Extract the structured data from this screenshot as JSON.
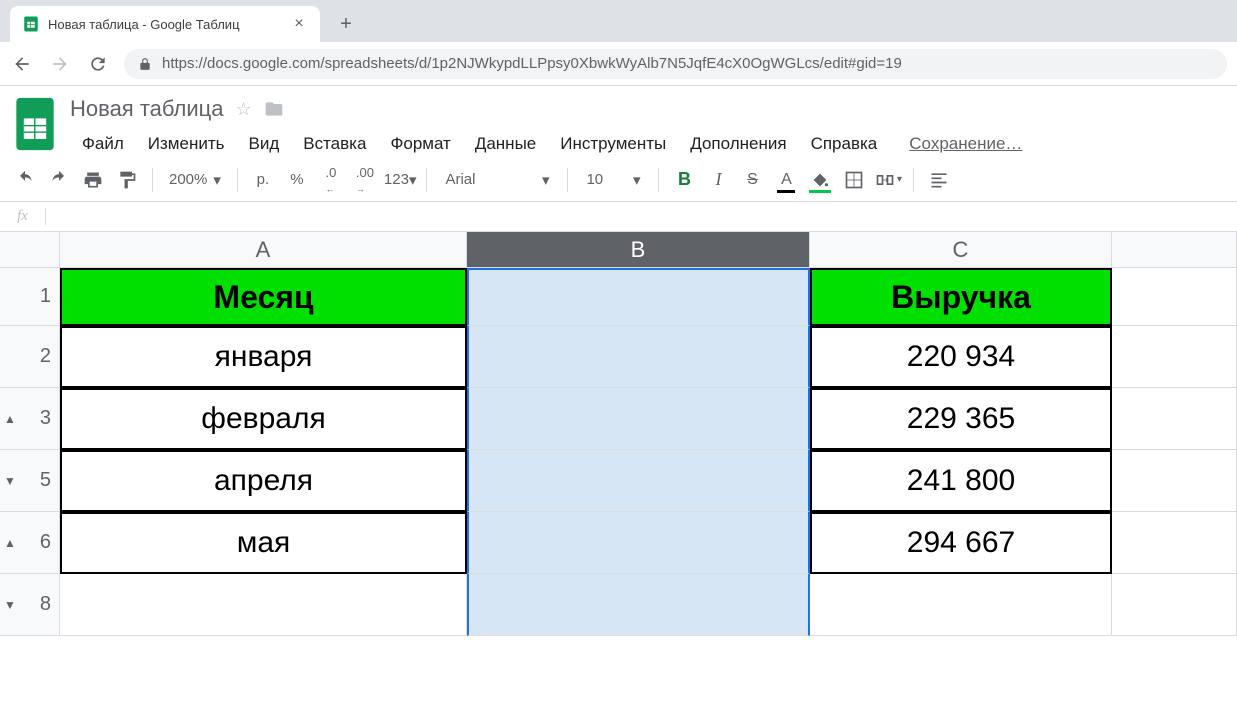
{
  "browser": {
    "tab_title": "Новая таблица - Google Таблиц",
    "url": "https://docs.google.com/spreadsheets/d/1p2NJWkypdLLPpsy0XbwkWyAlb7N5JqfE4cX0OgWGLcs/edit#gid=19"
  },
  "doc": {
    "title": "Новая таблица",
    "saving": "Сохранение…"
  },
  "menus": [
    "Файл",
    "Изменить",
    "Вид",
    "Вставка",
    "Формат",
    "Данные",
    "Инструменты",
    "Дополнения",
    "Справка"
  ],
  "toolbar": {
    "zoom": "200%",
    "currency": "р.",
    "percent": "%",
    "dec_dec": ".0",
    "inc_dec": ".00",
    "more_fmt": "123",
    "font": "Arial",
    "font_size": "10",
    "bold": "B",
    "italic": "I",
    "strike": "S",
    "textcolor": "A"
  },
  "formula_bar": {
    "fx": "fx",
    "value": ""
  },
  "columns": [
    "A",
    "B",
    "C"
  ],
  "selected_column": "B",
  "row_numbers": [
    "1",
    "2",
    "3",
    "5",
    "6",
    "8"
  ],
  "row_group_markers": {
    "2": "▲",
    "3": "▼",
    "4": "▲",
    "5": "▼"
  },
  "sheet": {
    "header": {
      "A": "Месяц",
      "B": "",
      "C": "Выручка"
    },
    "rows": [
      {
        "A": "января",
        "B": "",
        "C": "220 934"
      },
      {
        "A": "февраля",
        "B": "",
        "C": "229 365"
      },
      {
        "A": "апреля",
        "B": "",
        "C": "241 800"
      },
      {
        "A": "мая",
        "B": "",
        "C": "294 667"
      }
    ]
  },
  "colors": {
    "header_bg": "#00e000",
    "selection_bg": "#d6e6f5",
    "selection_border": "#1a73e8"
  }
}
